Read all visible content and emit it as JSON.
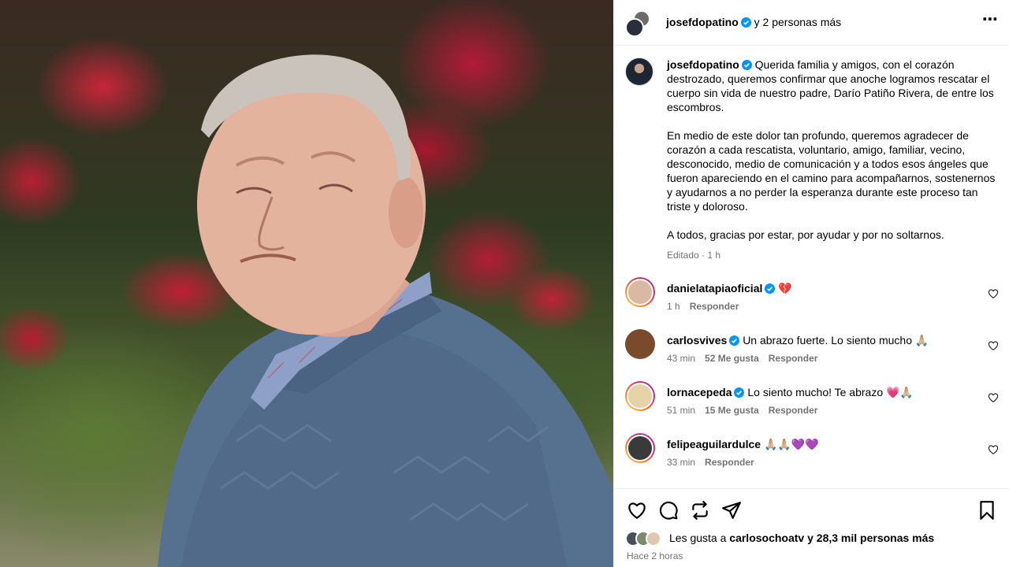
{
  "post": {
    "header": {
      "username": "josefdopatino",
      "coauthors": "y 2 personas más"
    },
    "caption": {
      "username": "josefdopatino",
      "paragraphs": [
        "Querida familia y amigos, con el corazón destrozado, queremos confirmar que anoche logramos rescatar el cuerpo sin vida de nuestro padre, Darío Patiño Rivera, de entre los escombros.",
        "En medio de este dolor tan profundo, queremos agradecer de corazón a cada rescatista, voluntario, amigo, familiar, vecino, desconocido, medio de comunicación y a todos esos ángeles que fueron apareciendo en el camino para acompañarnos, sostenernos y ayudarnos a no perder la esperanza durante este proceso tan triste y doloroso.",
        "A todos, gracias por estar, por ayudar y por no soltarnos."
      ],
      "meta": "Editado · 1 h"
    },
    "comments": [
      {
        "username": "danielatapiaoficial",
        "text": "💔",
        "time": "1 h",
        "likes": "",
        "reply": "Responder",
        "avatar_color": "#d9b9a1"
      },
      {
        "username": "carlosvives",
        "text": "Un abrazo fuerte. Lo siento mucho 🙏🏼",
        "time": "43 min",
        "likes": "52 Me gusta",
        "reply": "Responder",
        "avatar_color": "#7a4a2d"
      },
      {
        "username": "lornacepeda",
        "text": "Lo siento mucho! Te abrazo 💗🙏🏼",
        "time": "51 min",
        "likes": "15 Me gusta",
        "reply": "Responder",
        "avatar_color": "#e7d3a8"
      },
      {
        "username": "felipeaguilardulce",
        "text": "🙏🏼🙏🏼💜💜",
        "time": "33 min",
        "likes": "",
        "reply": "Responder",
        "avatar_color": "#3a3a3a"
      }
    ],
    "likes_text_prefix": "Les gusta a ",
    "likes_user": "carlosochoatv",
    "likes_text_suffix": " y 28,3 mil personas más",
    "time_ago": "Hace 2 horas"
  },
  "icons": {
    "more": "more-options-icon",
    "verified": "verified-badge-icon",
    "like": "heart-icon",
    "comment": "comment-icon",
    "repost": "repost-icon",
    "share": "send-icon",
    "save": "bookmark-icon"
  },
  "colors": {
    "verified": "#0095f6",
    "muted": "#737373",
    "divider": "#efefef"
  }
}
